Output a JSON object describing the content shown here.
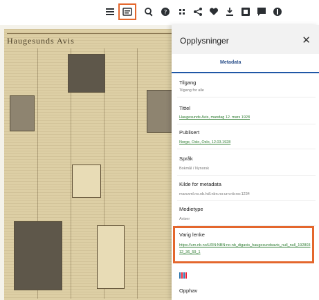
{
  "toolbar": {
    "icons": [
      "menu-icon",
      "info-icon",
      "search-icon",
      "help-icon",
      "grid-icon",
      "share-icon",
      "favorite-icon",
      "download-icon",
      "export-icon",
      "comment-icon",
      "more-icon"
    ]
  },
  "newspaper": {
    "masthead": "Haugesunds Avis"
  },
  "panel": {
    "title": "Opplysninger",
    "close": "✕",
    "tab": "Metadata",
    "fields": [
      {
        "label": "Tilgang",
        "value": "Tilgang for alle"
      },
      {
        "label": "Tittel",
        "value": "Haugesunds Avis, mandag 12. mars 1928",
        "link": "Haugesunds Avis"
      },
      {
        "label": "Publisert",
        "value": "Norge, Oslo, Oslo, 12.03.1928"
      },
      {
        "label": "Språk",
        "value": "Bokmål / Nynorsk"
      },
      {
        "label": "Kilde for metadata",
        "value": "marcxml.no.nb.hdl.nbn.no:urn:nb:no:1234"
      },
      {
        "label": "Medietype",
        "value": "Aviser"
      },
      {
        "label": "Varig lenke",
        "value": "https://urn.nb.no/URN:NBN:no-nb_digavis_haugesundsavis_null_null_19280312_36_59_1"
      },
      {
        "label": "Opphav",
        "value": ""
      }
    ]
  },
  "colors": {
    "accent": "#e4672d",
    "link": "#2e7d32",
    "tab": "#1f57a6"
  }
}
